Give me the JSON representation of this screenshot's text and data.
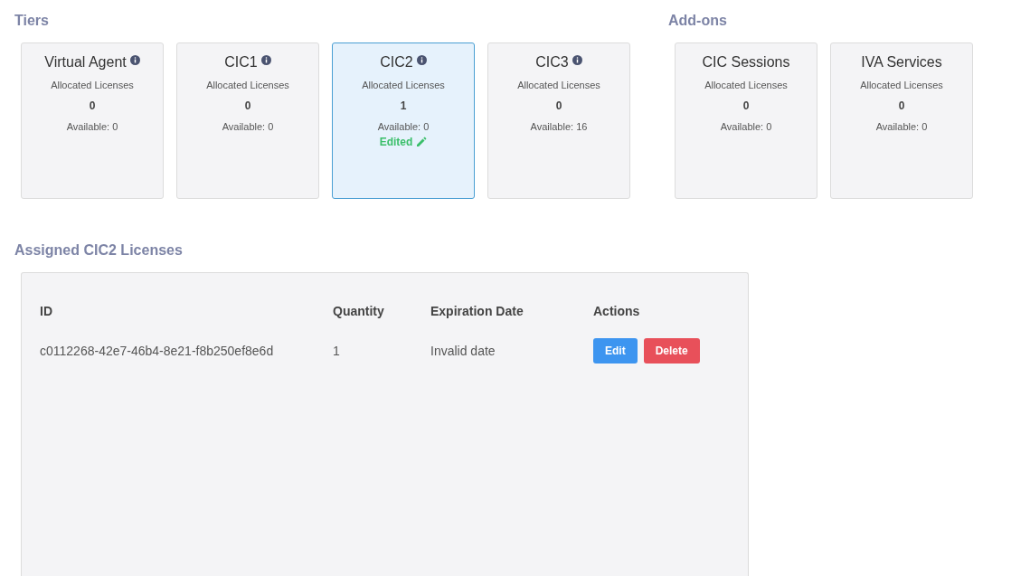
{
  "tiers": {
    "title": "Tiers",
    "cards": [
      {
        "name": "Virtual Agent",
        "info": true,
        "label": "Allocated Licenses",
        "allocated": "0",
        "available": "Available: 0",
        "selected": false
      },
      {
        "name": "CIC1",
        "info": true,
        "label": "Allocated Licenses",
        "allocated": "0",
        "available": "Available: 0",
        "selected": false
      },
      {
        "name": "CIC2",
        "info": true,
        "label": "Allocated Licenses",
        "allocated": "1",
        "available": "Available: 0",
        "selected": true,
        "edited": "Edited"
      },
      {
        "name": "CIC3",
        "info": true,
        "label": "Allocated Licenses",
        "allocated": "0",
        "available": "Available: 16",
        "selected": false
      }
    ]
  },
  "addons": {
    "title": "Add-ons",
    "cards": [
      {
        "name": "CIC Sessions",
        "info": false,
        "label": "Allocated Licenses",
        "allocated": "0",
        "available": "Available: 0",
        "selected": false
      },
      {
        "name": "IVA Services",
        "info": false,
        "label": "Allocated Licenses",
        "allocated": "0",
        "available": "Available: 0",
        "selected": false
      }
    ]
  },
  "assigned": {
    "title": "Assigned CIC2 Licenses",
    "columns": [
      "ID",
      "Quantity",
      "Expiration Date",
      "Actions"
    ],
    "rows": [
      {
        "id": "c0112268-42e7-46b4-8e21-f8b250ef8e6d",
        "quantity": "1",
        "expiration": "Invalid date",
        "actions": [
          {
            "label": "Edit",
            "kind": "edit"
          },
          {
            "label": "Delete",
            "kind": "delete"
          }
        ]
      }
    ]
  }
}
